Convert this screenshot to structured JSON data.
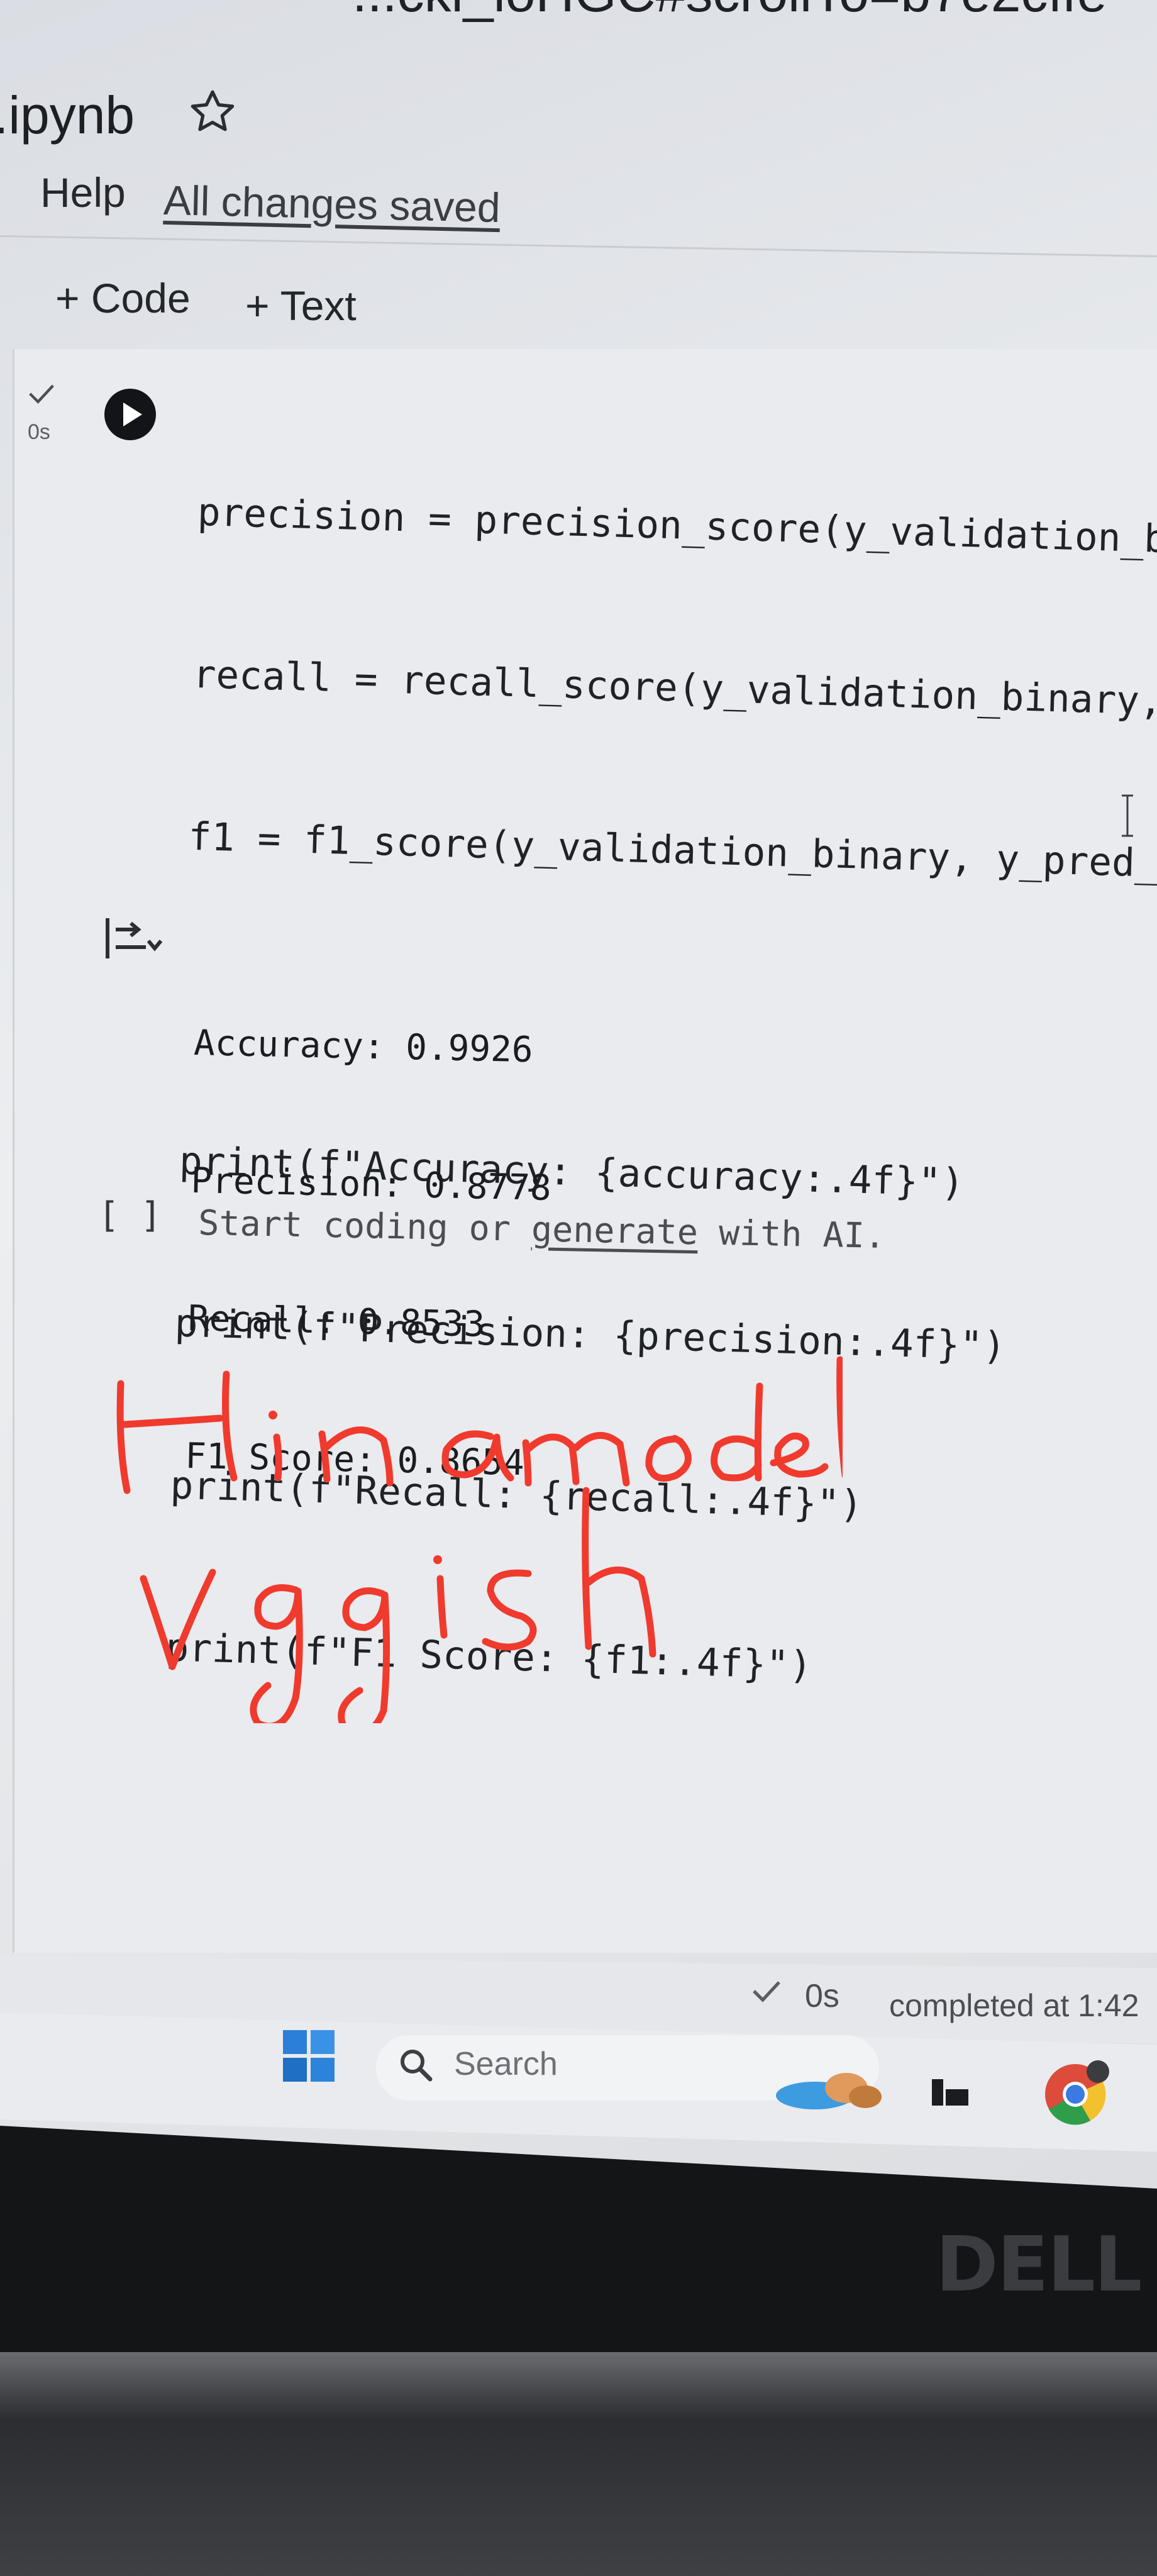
{
  "browser": {
    "url_fragment": "...cki_loHGC#scrollTo=b7e2cffe-"
  },
  "notebook": {
    "title": ".ipynb",
    "menu": {
      "help": "Help",
      "save_status": "All changes saved"
    },
    "toolbar": {
      "add_code": "+ Code",
      "add_text": "+ Text"
    }
  },
  "cell": {
    "exec_time": "0s",
    "code_lines": [
      "precision = precision_score(y_validation_bin",
      "recall = recall_score(y_validation_binary, y",
      "f1 = f1_score(y_validation_binary, y_pred_bi",
      "",
      "print(f\"Accuracy: {accuracy:.4f}\")",
      "print(f\"Precision: {precision:.4f}\")",
      "print(f\"Recall: {recall:.4f}\")",
      "print(f\"F1 Score: {f1:.4f}\")"
    ],
    "output_lines": [
      "Accuracy: 0.9926",
      "Precision: 0.8778",
      "Recall: 0.8533",
      "F1 Score: 0.8654"
    ]
  },
  "empty_cell": {
    "brackets": "[ ]",
    "prompt_before": "Start coding or ",
    "prompt_link": "generate",
    "prompt_after": " with AI."
  },
  "annotation": {
    "line1": "Hina model",
    "line2": "vggish",
    "color": "#f03a2e"
  },
  "status_bar": {
    "time": "0s",
    "completed": "completed at 1:42"
  },
  "taskbar": {
    "search_label": "Search"
  },
  "device": {
    "brand": "DELL"
  }
}
